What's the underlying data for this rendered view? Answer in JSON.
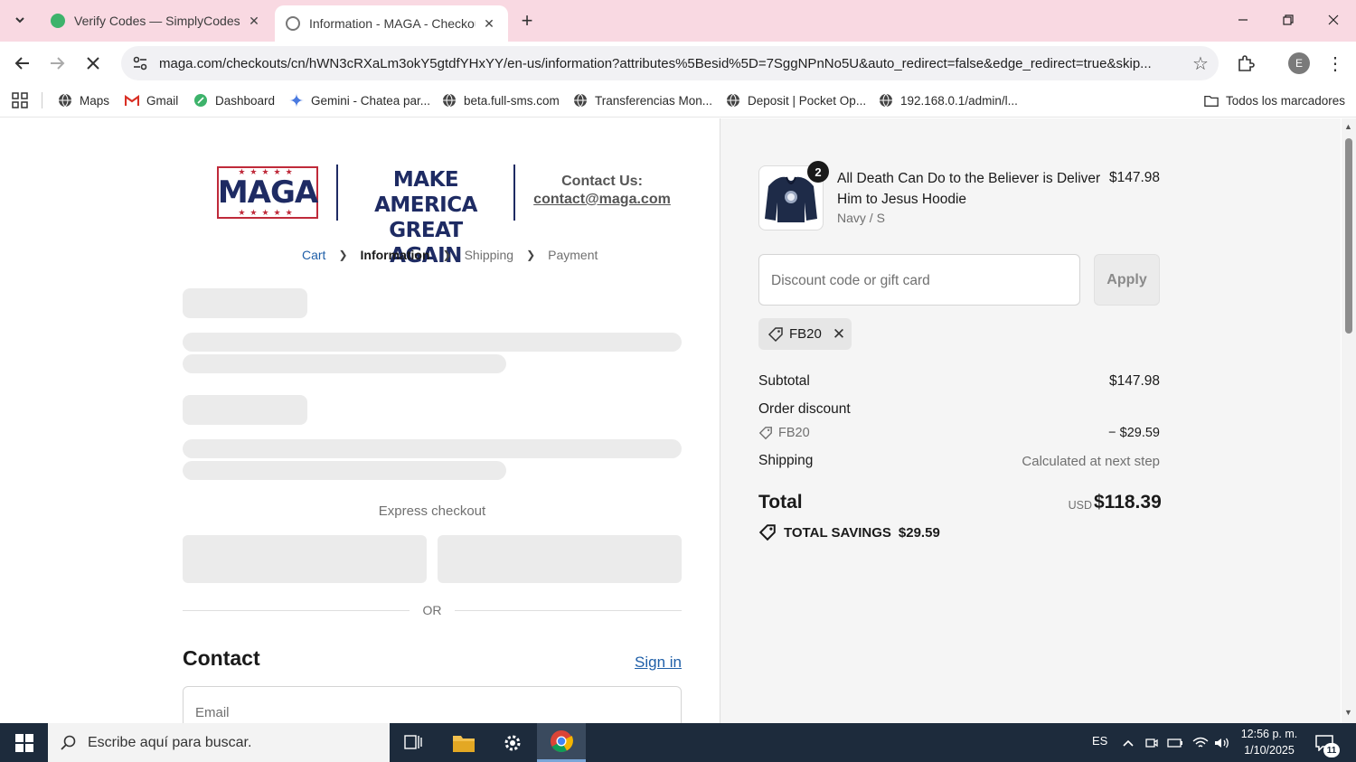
{
  "browser": {
    "tabs": [
      {
        "title": "Verify Codes — SimplyCodes",
        "active": false
      },
      {
        "title": "Information - MAGA - Checkout",
        "active": true
      }
    ],
    "url": "maga.com/checkouts/cn/hWN3cRXaLm3okY5gtdfYHxYY/en-us/information?attributes%5Besid%5D=7SggNPnNo5U&auto_redirect=false&edge_redirect=true&skip...",
    "profile_initial": "E",
    "bookmarks": [
      {
        "label": "Maps",
        "icon": "globe-icon"
      },
      {
        "label": "Gmail",
        "icon": "gmail-icon"
      },
      {
        "label": "Dashboard",
        "icon": "leaf-icon"
      },
      {
        "label": "Gemini - Chatea par...",
        "icon": "gemini-icon"
      },
      {
        "label": "beta.full-sms.com",
        "icon": "globe-icon"
      },
      {
        "label": "Transferencias Mon...",
        "icon": "globe-icon"
      },
      {
        "label": "Deposit | Pocket Op...",
        "icon": "globe-icon"
      },
      {
        "label": "192.168.0.1/admin/l...",
        "icon": "globe-icon"
      }
    ],
    "all_bookmarks": "Todos los marcadores"
  },
  "header": {
    "logo_text": "MAGA",
    "logo_stars": "★★★★★",
    "slogan_line1": "MAKE AMERICA",
    "slogan_line2": "GREAT AGAIN",
    "contact_label": "Contact Us:",
    "contact_email": "contact@maga.com"
  },
  "breadcrumb": {
    "items": [
      "Cart",
      "Information",
      "Shipping",
      "Payment"
    ]
  },
  "checkout": {
    "express_label": "Express checkout",
    "or_label": "OR",
    "contact_title": "Contact",
    "sign_in": "Sign in",
    "email_placeholder": "Email"
  },
  "summary": {
    "product": {
      "name": "All Death Can Do to the Believer is Deliver Him to Jesus Hoodie",
      "variant": "Navy / S",
      "price": "$147.98",
      "quantity": "2"
    },
    "discount_placeholder": "Discount code or gift card",
    "apply_label": "Apply",
    "applied_code": "FB20",
    "subtotal_label": "Subtotal",
    "subtotal_value": "$147.98",
    "order_discount_label": "Order discount",
    "discount_code": "FB20",
    "discount_amount": "− $29.59",
    "shipping_label": "Shipping",
    "shipping_value": "Calculated at next step",
    "total_label": "Total",
    "currency": "USD",
    "total_value": "$118.39",
    "savings_label": "TOTAL SAVINGS",
    "savings_value": "$29.59"
  },
  "taskbar": {
    "search_placeholder": "Escribe aquí para buscar.",
    "language": "ES",
    "time": "12:56 p. m.",
    "date": "1/10/2025",
    "notification_count": "11"
  },
  "colors": {
    "tabbar": "#f9d9e2",
    "brand_navy": "#1e2b63",
    "brand_red": "#bf2a3a",
    "link_blue": "#1f5fa8",
    "taskbar": "#1d2b3c"
  }
}
